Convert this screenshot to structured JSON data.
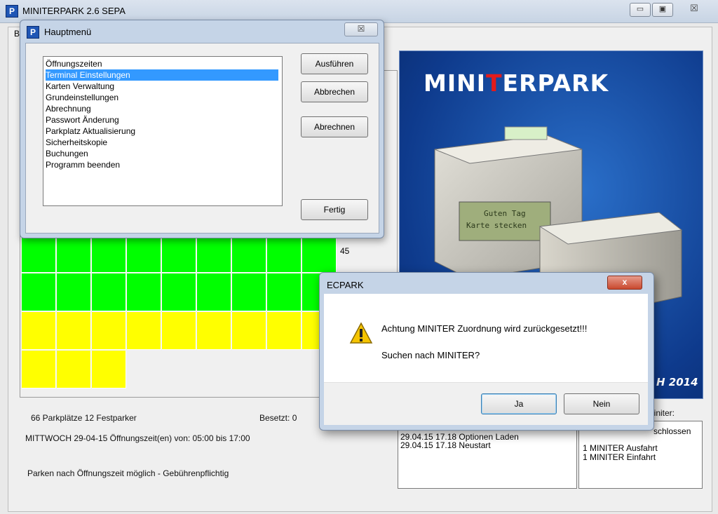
{
  "main_window": {
    "title": "MINITERPARK 2.6  SEPA",
    "menu_first_letter": "B",
    "controls": {
      "minimize": "▭",
      "maximize": "▣",
      "close": "☒"
    }
  },
  "grid": {
    "row_label": "45",
    "rows": [
      {
        "color": "#00ff00",
        "cells": 9
      },
      {
        "color": "#00ff00",
        "cells": 9
      },
      {
        "color": "#ffff00",
        "cells": 9
      },
      {
        "color": "#ffff00",
        "cells": 3
      }
    ]
  },
  "info": {
    "parkplaetze": "66 Parkplätze  12 Festparker",
    "besetzt": "Besetzt:  0",
    "day_line": "MITTWOCH   29-04-15  Öffnungszeit(en) von: 05:00 bis 17:00",
    "parken_line": "Parken nach Öffnungszeit möglich - Gebührenpflichtig"
  },
  "promo": {
    "logo_pre": "MINI",
    "logo_red": "T",
    "logo_post": "ERPARK",
    "screen_text_1": "Guten Tag",
    "screen_text_2": "Karte stecken",
    "year_text": "H 2014"
  },
  "log": {
    "lines": [
      "29.04.15  17.18 Optionen Laden",
      "29.04.15  17.18 Neustart"
    ]
  },
  "miniter": {
    "label": "liniter:",
    "lines": [
      "schlossen",
      "",
      "1 MINITER Ausfahrt",
      "1 MINITER Einfahrt"
    ]
  },
  "hauptmenu": {
    "title": "Hauptmenü",
    "close": "☒",
    "items": [
      "Öffnungszeiten",
      "Terminal Einstellungen",
      "Karten Verwaltung",
      "Grundeinstellungen",
      "Abrechnung",
      "Passwort Änderung",
      "Parkplatz Aktualisierung",
      "Sicherheitskopie",
      "Buchungen",
      "Programm beenden"
    ],
    "selected_index": 1,
    "buttons": {
      "ausfuehren": "Ausführen",
      "abbrechen": "Abbrechen",
      "abrechnen": "Abrechnen",
      "fertig": "Fertig"
    }
  },
  "ecpark": {
    "title": "ECPARK",
    "close": "x",
    "message_1": "Achtung MINITER Zuordnung wird zurückgesetzt!!!",
    "message_2": "Suchen nach MINITER?",
    "yes": "Ja",
    "no": "Nein"
  }
}
